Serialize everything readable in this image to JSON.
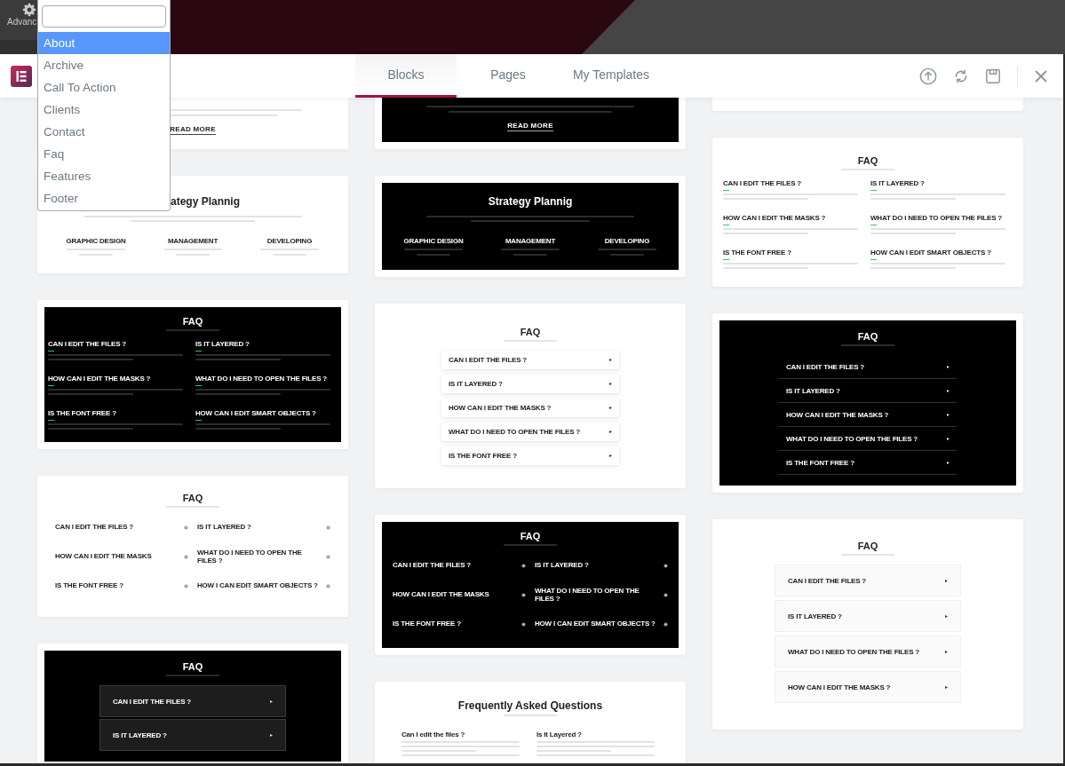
{
  "editor": {
    "panel_label": "Advanc"
  },
  "dropdown": {
    "items": [
      {
        "label": "About",
        "selected": true
      },
      {
        "label": "Archive",
        "selected": false
      },
      {
        "label": "Call To Action",
        "selected": false
      },
      {
        "label": "Clients",
        "selected": false
      },
      {
        "label": "Contact",
        "selected": false
      },
      {
        "label": "Faq",
        "selected": false
      },
      {
        "label": "Features",
        "selected": false
      },
      {
        "label": "Footer",
        "selected": false
      }
    ]
  },
  "header": {
    "tabs": [
      {
        "label": "Blocks",
        "selected": true
      },
      {
        "label": "Pages",
        "selected": false
      },
      {
        "label": "My Templates",
        "selected": false
      }
    ]
  },
  "columns": [
    {
      "cards": [
        {
          "kind": "cut_light",
          "link": "READ MORE"
        },
        {
          "kind": "strategy_light",
          "title": "ategy Plannig",
          "features": [
            "GRAPHIC DESIGN",
            "MANAGEMENT",
            "DEVELOPING"
          ]
        },
        {
          "kind": "grid_dark",
          "title": "FAQ",
          "questions": [
            "CAN I EDIT THE FILES ?",
            "IS IT LAYERED ?",
            "HOW CAN I EDIT THE MASKS ?",
            "WHAT DO I NEED TO OPEN THE FILES ?",
            "IS THE FONT FREE ?",
            "HOW CAN I EDIT SMART OBJECTS ?"
          ]
        },
        {
          "kind": "toggles_light",
          "title": "FAQ",
          "questions": [
            "CAN I EDIT THE FILES ?",
            "IS IT LAYERED ?",
            "HOW CAN I EDIT THE MASKS",
            "WHAT DO I NEED TO OPEN THE FILES ?",
            "IS THE FONT FREE ?",
            "HOW I CAN EDIT SMART OBJECTS ?"
          ]
        },
        {
          "kind": "boxes_dark",
          "title": "FAQ",
          "questions": [
            "CAN I EDIT THE FILES ?",
            "IS IT LAYERED ?"
          ]
        }
      ]
    },
    {
      "cards": [
        {
          "kind": "cut_dark",
          "link": "READ MORE"
        },
        {
          "kind": "strategy_dark",
          "title": "Strategy Plannig",
          "features": [
            "GRAPHIC DESIGN",
            "MANAGEMENT",
            "DEVELOPING"
          ]
        },
        {
          "kind": "cards_light",
          "title": "FAQ",
          "questions": [
            "CAN I EDIT THE FILES ?",
            "IS IT LAYERED ?",
            "HOW CAN I EDIT THE MASKS ?",
            "WHAT DO I NEED TO OPEN THE FILES ?",
            "IS THE FONT FREE ?"
          ]
        },
        {
          "kind": "toggles_dark",
          "title": "FAQ",
          "questions": [
            "CAN I EDIT THE FILES ?",
            "IS IT LAYERED ?",
            "HOW CAN I EDIT THE MASKS",
            "WHAT DO I NEED TO OPEN THE FILES ?",
            "IS THE FONT FREE ?",
            "HOW I CAN EDIT SMART OBJECTS ?"
          ]
        },
        {
          "kind": "text_light",
          "title": "Frequently Asked Questions",
          "questions": [
            "Can I edit the files ?",
            "Is It Layered ?"
          ]
        }
      ]
    },
    {
      "cards": [
        {
          "kind": "cut_light"
        },
        {
          "kind": "grid_light",
          "title": "FAQ",
          "questions": [
            "CAN I EDIT THE FILES ?",
            "IS IT LAYERED ?",
            "HOW CAN I EDIT THE MASKS ?",
            "WHAT DO I NEED TO OPEN THE FILES ?",
            "IS THE FONT FREE ?",
            "HOW CAN I EDIT SMART OBJECTS ?"
          ]
        },
        {
          "kind": "lined_dark",
          "title": "FAQ",
          "questions": [
            "CAN I EDIT THE FILES ?",
            "IS IT LAYERED ?",
            "HOW CAN I EDIT THE MASKS ?",
            "WHAT DO I NEED TO OPEN THE FILES ?",
            "IS THE FONT FREE ?"
          ]
        },
        {
          "kind": "boxes_light",
          "title": "FAQ",
          "questions": [
            "CAN I EDIT THE FILES ?",
            "IS IT LAYERED ?",
            "WHAT DO I NEED TO OPEN THE FILES ?",
            "HOW CAN I EDIT THE MASKS ?"
          ]
        }
      ]
    }
  ]
}
